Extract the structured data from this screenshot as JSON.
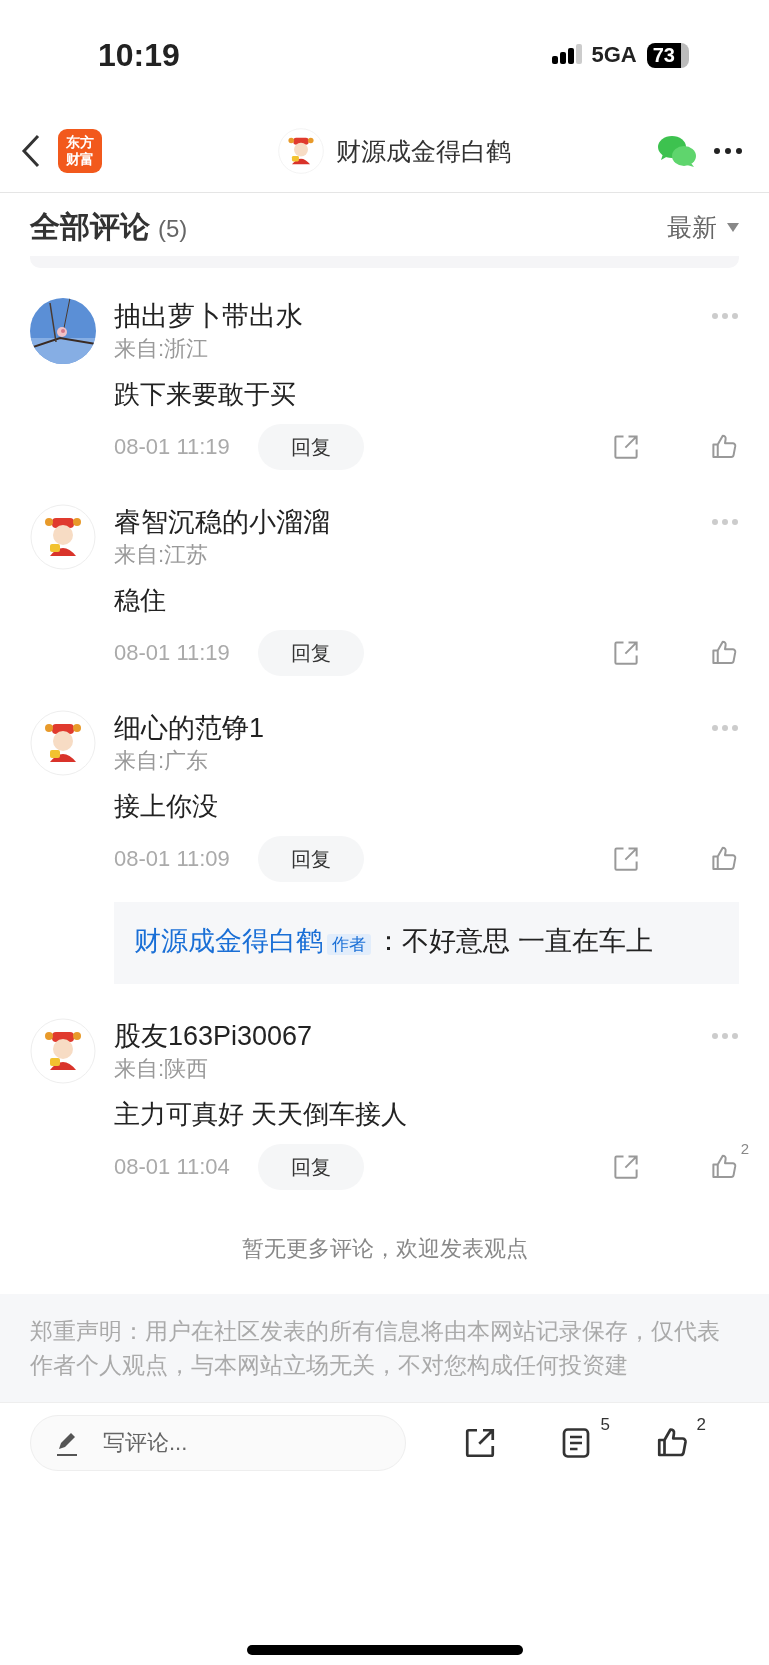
{
  "status_bar": {
    "time": "10:19",
    "network": "5GA",
    "battery": "73"
  },
  "header": {
    "logo_lines": [
      "东方",
      "财富"
    ],
    "title": "财源成金得白鹤"
  },
  "section": {
    "title": "全部评论",
    "count": "(5)",
    "sort": "最新"
  },
  "comments": [
    {
      "kind": "picture",
      "name": "抽出萝卜带出水",
      "location": "来自:浙江",
      "text": "跌下来要敢于买",
      "time": "08-01 11:19",
      "reply_label": "回复"
    },
    {
      "kind": "mascot",
      "name": "睿智沉稳的小溜溜",
      "location": "来自:江苏",
      "text": "稳住",
      "time": "08-01 11:19",
      "reply_label": "回复"
    },
    {
      "kind": "mascot",
      "name": "细心的范铮1",
      "location": "来自:广东",
      "text": "接上你没",
      "time": "08-01 11:09",
      "reply_label": "回复",
      "replies": [
        {
          "author": "财源成金得白鹤",
          "badge": "作者",
          "separator": "：",
          "text": "不好意思  一直在车上"
        }
      ]
    },
    {
      "kind": "mascot",
      "name": "股友163Pi30067",
      "location": "来自:陕西",
      "text": "主力可真好 天天倒车接人",
      "time": "08-01 11:04",
      "reply_label": "回复",
      "likes": "2"
    }
  ],
  "end_note": "暂无更多评论，欢迎发表观点",
  "disclaimer": "郑重声明：用户在社区发表的所有信息将由本网站记录保存，仅代表作者个人观点，与本网站立场无关，不对您构成任何投资建",
  "bottom_bar": {
    "placeholder": "写评论...",
    "comment_count": "5",
    "like_count": "2"
  }
}
